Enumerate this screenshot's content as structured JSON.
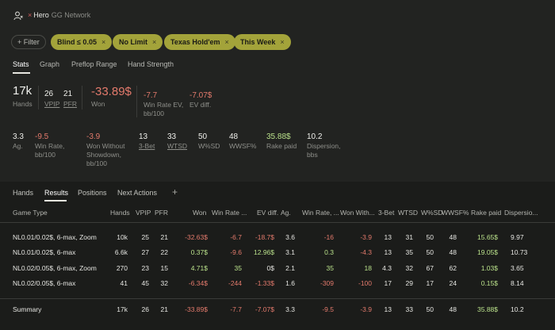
{
  "header": {
    "close_mark": "×",
    "user": "Hero",
    "network": "GG Network"
  },
  "filters": {
    "add_label": "+ Filter",
    "chips": [
      {
        "label": "Blind ≤ 0.05"
      },
      {
        "label": "No Limit"
      },
      {
        "label": "Texas Hold'em"
      },
      {
        "label": "This Week"
      }
    ],
    "chip_close": "×"
  },
  "tabs": [
    "Stats",
    "Graph",
    "Preflop Range",
    "Hand Strength"
  ],
  "stats": {
    "hands": {
      "value": "17k",
      "label": "Hands"
    },
    "vpip": {
      "value": "26",
      "label": "VPIP"
    },
    "pfr": {
      "value": "21",
      "label": "PFR"
    },
    "won": {
      "value": "-33.89$",
      "label": "Won"
    },
    "wr_ev": {
      "value": "-7.7",
      "label1": "Win Rate EV,",
      "label2": "bb/100"
    },
    "ev_diff": {
      "value": "-7.07$",
      "label": "EV diff."
    },
    "ag": {
      "value": "3.3",
      "label": "Ag."
    },
    "win_rate": {
      "value": "-9.5",
      "label1": "Win Rate,",
      "label2": "bb/100"
    },
    "wwsd": {
      "value": "-3.9",
      "label1": "Won Without",
      "label2": "Showdown,",
      "label3": "bb/100"
    },
    "threebet": {
      "value": "13",
      "label": "3-Bet"
    },
    "wtsd": {
      "value": "33",
      "label": "WTSD"
    },
    "wsd": {
      "value": "50",
      "label": "W%SD"
    },
    "wwsf": {
      "value": "48",
      "label": "WWSF%"
    },
    "rake": {
      "value": "35.88$",
      "label": "Rake paid"
    },
    "dispersion": {
      "value": "10.2",
      "label1": "Dispersion,",
      "label2": "bbs"
    }
  },
  "bottom_tabs": [
    "Hands",
    "Results",
    "Positions",
    "Next Actions"
  ],
  "add_tab": "+",
  "table": {
    "columns": [
      "Game Type",
      "Hands",
      "VPIP",
      "PFR",
      "Won",
      "Win Rate ...",
      "EV diff.",
      "Ag.",
      "Win Rate, ...",
      "Won With...",
      "3-Bet",
      "WTSD",
      "W%SD",
      "WWSF%",
      "Rake paid",
      "Dispersio..."
    ],
    "rows": [
      [
        "NL0.01/0.02$, 6-max, Zoom",
        "10k",
        "25",
        "21",
        "-32.63$",
        "-6.7",
        "-18.7$",
        "3.6",
        "-16",
        "-3.9",
        "13",
        "31",
        "50",
        "48",
        "15.65$",
        "9.97"
      ],
      [
        "NL0.01/0.02$, 6-max",
        "6.6k",
        "27",
        "22",
        "0.37$",
        "-9.6",
        "12.96$",
        "3.1",
        "0.3",
        "-4.3",
        "13",
        "35",
        "50",
        "48",
        "19.05$",
        "10.73"
      ],
      [
        "NL0.02/0.05$, 6-max, Zoom",
        "270",
        "23",
        "15",
        "4.71$",
        "35",
        "0$",
        "2.1",
        "35",
        "18",
        "4.3",
        "32",
        "67",
        "62",
        "1.03$",
        "3.65"
      ],
      [
        "NL0.02/0.05$, 6-max",
        "41",
        "45",
        "32",
        "-6.34$",
        "-244",
        "-1.33$",
        "1.6",
        "-309",
        "-100",
        "17",
        "29",
        "17",
        "24",
        "0.15$",
        "8.14"
      ]
    ],
    "summary": [
      "Summary",
      "17k",
      "26",
      "21",
      "-33.89$",
      "-7.7",
      "-7.07$",
      "3.3",
      "-9.5",
      "-3.9",
      "13",
      "33",
      "50",
      "48",
      "35.88$",
      "10.2"
    ]
  },
  "colors": {
    "negative": "#e37a6c",
    "positive": "#b9e08a",
    "chip": "#a3a33a"
  }
}
